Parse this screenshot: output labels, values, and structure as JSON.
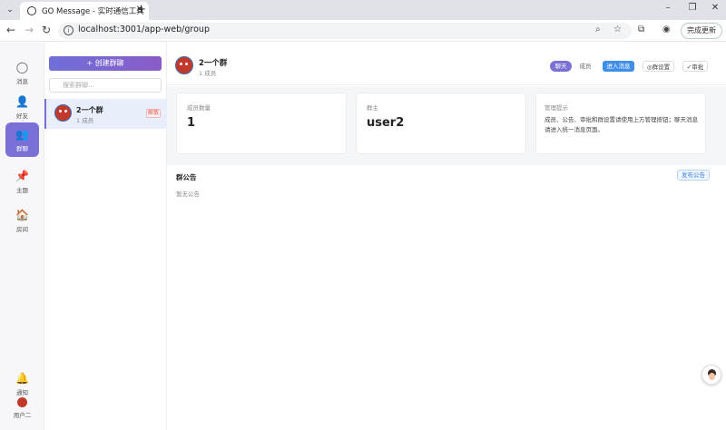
{
  "browser": {
    "tab_title": "GO Message - 实时通信工具",
    "tab_close": "✕",
    "new_tab": "+",
    "url": "localhost:3001/app-web/group",
    "update_label": "完成更新"
  },
  "sidebar": {
    "items": [
      {
        "label": "消息",
        "icon": "chat-bubble-icon",
        "glyph": "◯"
      },
      {
        "label": "好友",
        "icon": "person-icon",
        "glyph": "👤"
      },
      {
        "label": "群聊",
        "icon": "group-icon",
        "glyph": "👥"
      },
      {
        "label": "主题",
        "icon": "pin-icon",
        "glyph": "📌"
      },
      {
        "label": "房间",
        "icon": "house-icon",
        "glyph": "🏠"
      }
    ],
    "notify_label": "通知",
    "notify_glyph": "🔔",
    "user_label": "用户二"
  },
  "list": {
    "create_label": "+ 创建群聊",
    "search_placeholder": "搜索群聊...",
    "groups": [
      {
        "name": "2一个群",
        "sub": "1 成员",
        "badge": "解散"
      }
    ]
  },
  "header": {
    "name": "2一个群",
    "sub": "1 成员",
    "buttons": {
      "chat": "聊天",
      "members": "成员",
      "enter": "进入消息",
      "settings": "◎群设置",
      "review": "✓审批"
    }
  },
  "stats": {
    "members_label": "成员数量",
    "members_value": "1",
    "owner_label": "群主",
    "owner_value": "user2",
    "tip_label": "管理提示",
    "tip_text": "成员、公告、审批和群设置请使用上方管理按钮；聊天消息请进入统一消息页面。"
  },
  "announcement": {
    "title": "群公告",
    "publish_label": "发布公告",
    "empty_text": "暂无公告"
  },
  "colors": {
    "accent": "#7a70d6",
    "primary_button": "#3f8ee8",
    "danger": "#e35b5b"
  }
}
